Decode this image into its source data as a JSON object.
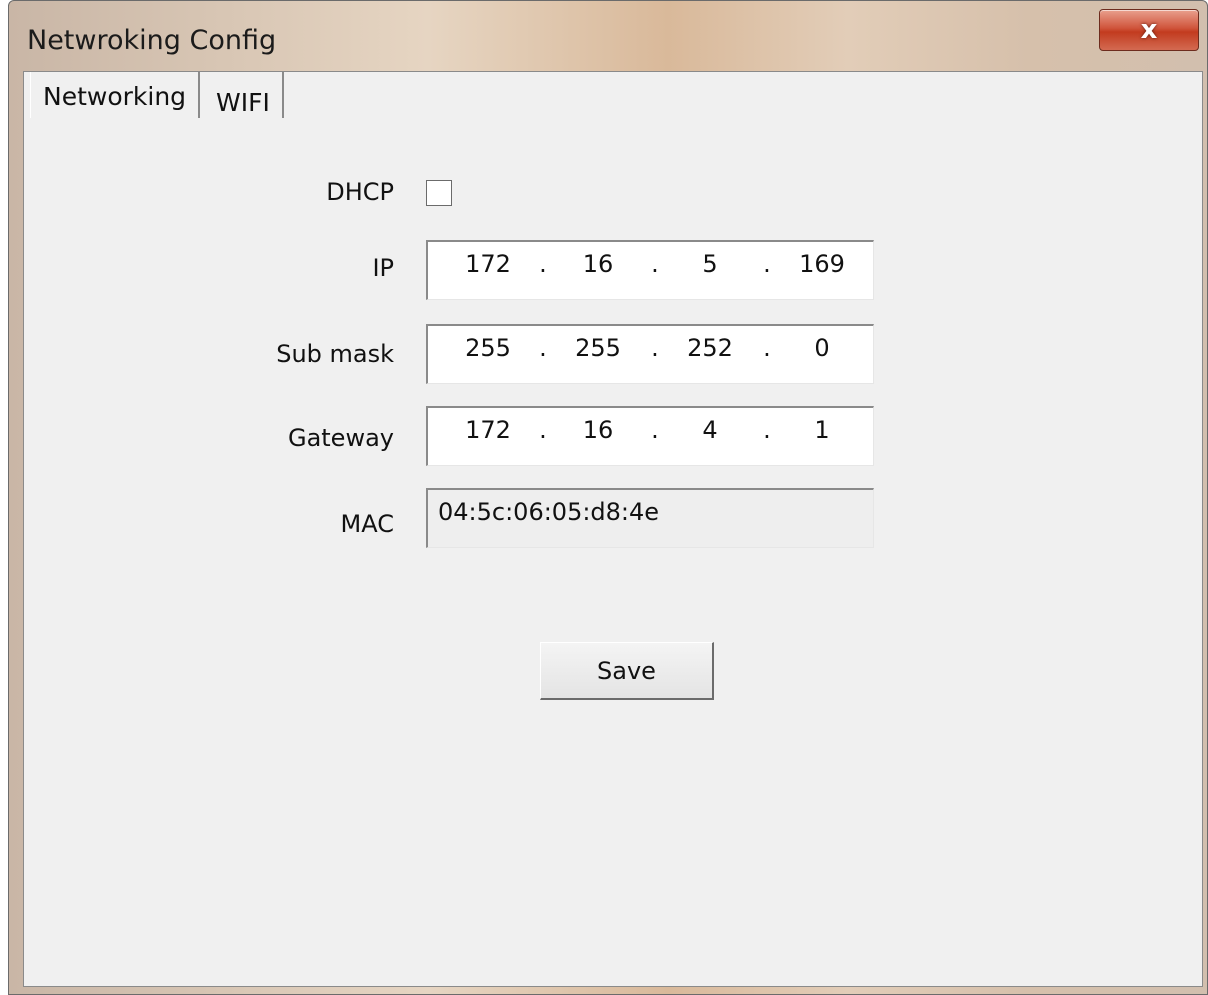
{
  "window": {
    "title": "Netwroking Config",
    "close_label": "x"
  },
  "tabs": [
    {
      "label": "Networking",
      "active": true
    },
    {
      "label": "WIFI",
      "active": false
    }
  ],
  "form": {
    "dhcp": {
      "label": "DHCP",
      "checked": false
    },
    "ip": {
      "label": "IP",
      "octets": [
        "172",
        "16",
        "5",
        "169"
      ]
    },
    "submask": {
      "label": "Sub mask",
      "octets": [
        "255",
        "255",
        "252",
        "0"
      ]
    },
    "gateway": {
      "label": "Gateway",
      "octets": [
        "172",
        "16",
        "4",
        "1"
      ]
    },
    "mac": {
      "label": "MAC",
      "value": "04:5c:06:05:d8:4e"
    },
    "dot": "."
  },
  "actions": {
    "save_label": "Save"
  }
}
